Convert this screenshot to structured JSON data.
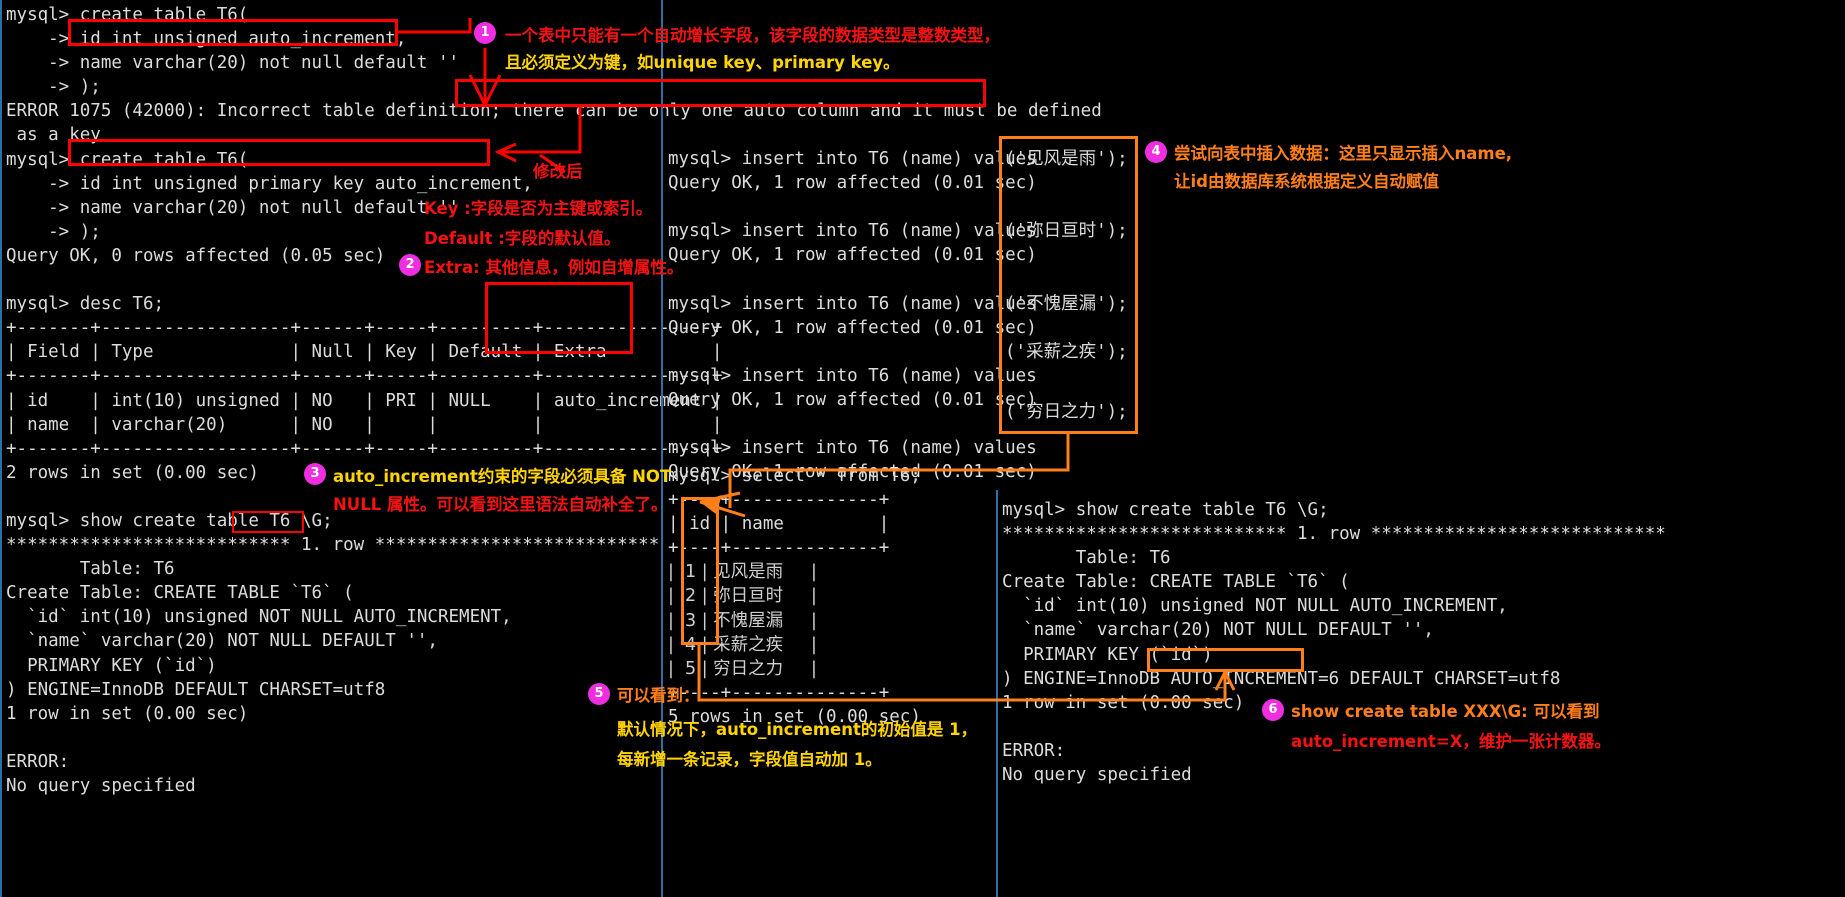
{
  "terminal": {
    "left_pane": {
      "lines": [
        "mysql> create table T6(",
        "    -> id int unsigned auto_increment,",
        "    -> name varchar(20) not null default ''",
        "    -> );",
        "ERROR 1075 (42000): Incorrect table definition; there can be only one auto column and it must be defined",
        " as a key",
        "mysql> create table T6(",
        "    -> id int unsigned primary key auto_increment,",
        "    -> name varchar(20) not null default ''",
        "    -> );",
        "Query OK, 0 rows affected (0.05 sec)",
        "",
        "mysql> desc T6;",
        "+-------+------------------+------+-----+---------+----------------+",
        "| Field | Type             | Null | Key | Default | Extra          |",
        "+-------+------------------+------+-----+---------+----------------+",
        "| id    | int(10) unsigned | NO   | PRI | NULL    | auto_increment |",
        "| name  | varchar(20)      | NO   |     |         |                |",
        "+-------+------------------+------+-----+---------+----------------+",
        "2 rows in set (0.00 sec)",
        "",
        "mysql> show create table T6 \\G;",
        "*************************** 1. row ***************************",
        "       Table: T6",
        "Create Table: CREATE TABLE `T6` (",
        "  `id` int(10) unsigned NOT NULL AUTO_INCREMENT,",
        "  `name` varchar(20) NOT NULL DEFAULT '',",
        "  PRIMARY KEY (`id`)",
        ") ENGINE=InnoDB DEFAULT CHARSET=utf8",
        "1 row in set (0.00 sec)",
        "",
        "ERROR:",
        "No query specified"
      ]
    },
    "middle_pane": {
      "insert_lines": [
        "mysql> insert into T6 (name) values",
        "Query OK, 1 row affected (0.01 sec)",
        "",
        "mysql> insert into T6 (name) values",
        "Query OK, 1 row affected (0.01 sec)",
        "",
        "mysql> insert into T6 (name) values",
        "Query OK, 1 row affected (0.01 sec)",
        "",
        "mysql> insert into T6 (name) values",
        "Query OK, 1 row affected (0.01 sec)",
        "",
        "mysql> insert into T6 (name) values",
        "Query OK, 1 row affected (0.01 sec)"
      ],
      "insert_values": [
        "('见风是雨');",
        "('弥日亘时');",
        "('不愧屋漏');",
        "('采薪之疾');",
        "('穷日之力');"
      ],
      "select_lines": [
        "mysql> select * from T6;",
        "+----+--------------+",
        "| id | name         |",
        "+----+--------------+",
        "|  1 | 见风是雨     |",
        "|  2 | 弥日亘时     |",
        "|  3 | 不愧屋漏     |",
        "|  4 | 采薪之疾     |",
        "|  5 | 穷日之力     |",
        "+----+--------------+",
        "5 rows in set (0.00 sec)"
      ]
    },
    "right_pane": {
      "lines": [
        "mysql> show create table T6 \\G;",
        "*************************** 1. row ****************************",
        "       Table: T6",
        "Create Table: CREATE TABLE `T6` (",
        "  `id` int(10) unsigned NOT NULL AUTO_INCREMENT,",
        "  `name` varchar(20) NOT NULL DEFAULT '',",
        "  PRIMARY KEY (`id`)",
        ") ENGINE=InnoDB AUTO_INCREMENT=6 DEFAULT CHARSET=utf8",
        "1 row in set (0.00 sec)",
        "",
        "ERROR:",
        "No query specified"
      ]
    }
  },
  "annotations": [
    {
      "number": "1",
      "lines": [
        "一个表中只能有一个自动增长字段，该字段的数据类型是整数类型，",
        "且必须定义为键，如unique key、primary key。"
      ],
      "colors": [
        "#f41212",
        "#ffd400"
      ]
    },
    {
      "number": "2",
      "lines": [
        "Key :字段是否为主键或索引。",
        "Default :字段的默认值。",
        "Extra: 其他信息，例如自增属性。"
      ],
      "colors": [
        "#f41212",
        "#f41212",
        "#f41212"
      ]
    },
    {
      "number": "3",
      "lines": [
        "auto_increment约束的字段必须具备 NOT",
        "NULL 属性。可以看到这里语法自动补全了。"
      ],
      "colors": [
        "#ffd400",
        "#f41212"
      ]
    },
    {
      "number": "4",
      "lines": [
        "尝试向表中插入数据：这里只显示插入name,",
        "让id由数据库系统根据定义自动赋值"
      ],
      "colors": [
        "#ff7f1a",
        "#ff7f1a"
      ]
    },
    {
      "number": "5",
      "lines": [
        "可以看到：",
        "默认情况下，auto_increment的初始值是 1，",
        "每新增一条记录，字段值自动加 1。"
      ],
      "colors": [
        "#ff7f1a",
        "#ffd400",
        "#ffd400"
      ]
    },
    {
      "number": "6",
      "lines": [
        "show create table XXX\\G: 可以看到",
        "auto_increment=X，维护一张计数器。"
      ],
      "colors": [
        "#ff7f1a",
        "#f41212"
      ]
    }
  ],
  "labels": {
    "after_modification": "修改后"
  },
  "colors": {
    "background": "#000000",
    "terminal_text": "#dcdcdc",
    "highlight_red": "#ff0000",
    "highlight_orange": "#ff7f1a",
    "badge": "#ee2ee0",
    "annotation_yellow": "#ffd400",
    "annotation_red": "#f41212",
    "gutter_blue": "#2f6fa8"
  }
}
